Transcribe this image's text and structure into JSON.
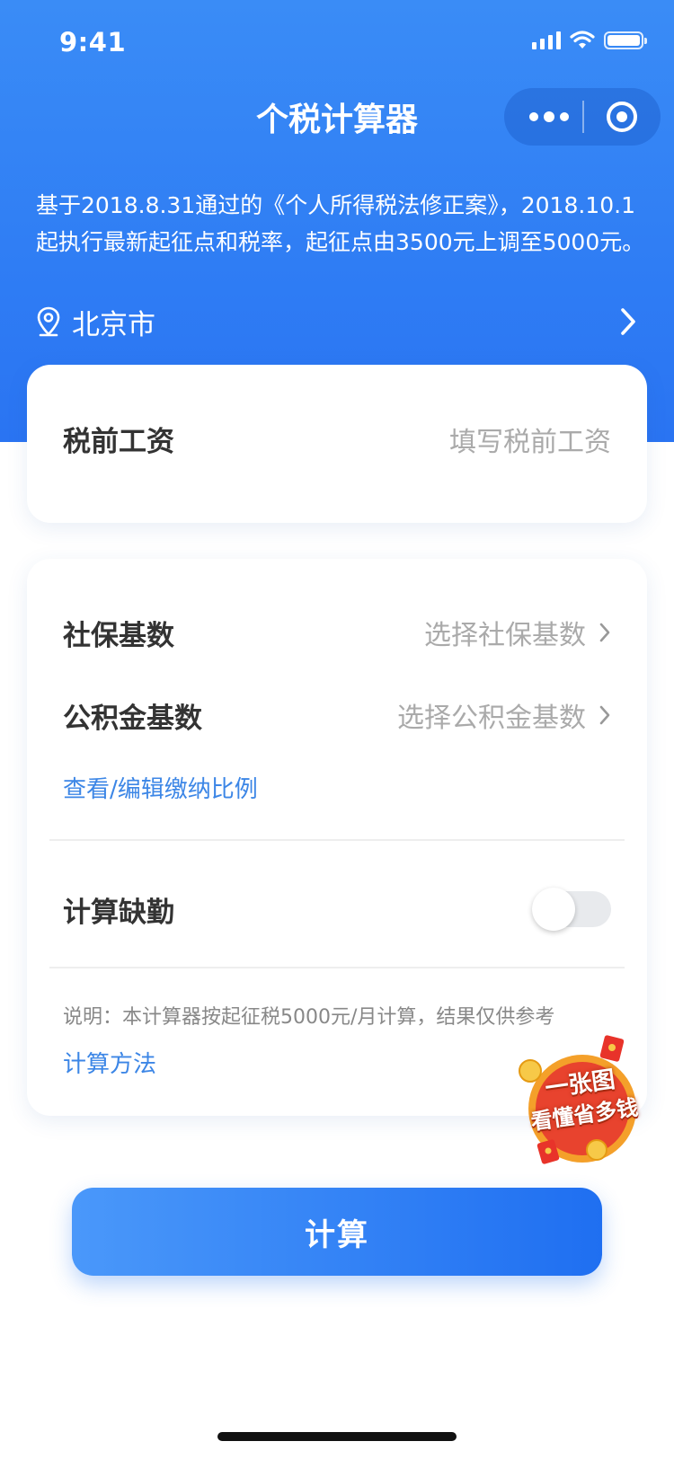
{
  "status_bar": {
    "time": "9:41",
    "battery_level": 1.0
  },
  "nav": {
    "title": "个税计算器"
  },
  "intro_text": "基于2018.8.31通过的《个人所得税法修正案》，2018.10.1起执行最新起征点和税率，起征点由3500元上调至5000元。",
  "location": {
    "city": "北京市",
    "icon": "location-pin-icon"
  },
  "salary": {
    "label": "税前工资",
    "placeholder": "填写税前工资"
  },
  "social_security": {
    "label": "社保基数",
    "value": "选择社保基数"
  },
  "housing_fund": {
    "label": "公积金基数",
    "value": "选择公积金基数"
  },
  "edit_ratio_link": "查看/编辑缴纳比例",
  "absence": {
    "label": "计算缺勤",
    "enabled": false
  },
  "note": {
    "text": "说明：本计算器按起征税5000元/月计算，结果仅供参考",
    "method_link": "计算方法"
  },
  "promo": {
    "line1": "一张图",
    "line2": "看懂省多钱"
  },
  "calculate_button": "计算",
  "colors": {
    "primary": "#2f7df4",
    "link": "#3c86e6",
    "promo_red": "#e8432e"
  }
}
